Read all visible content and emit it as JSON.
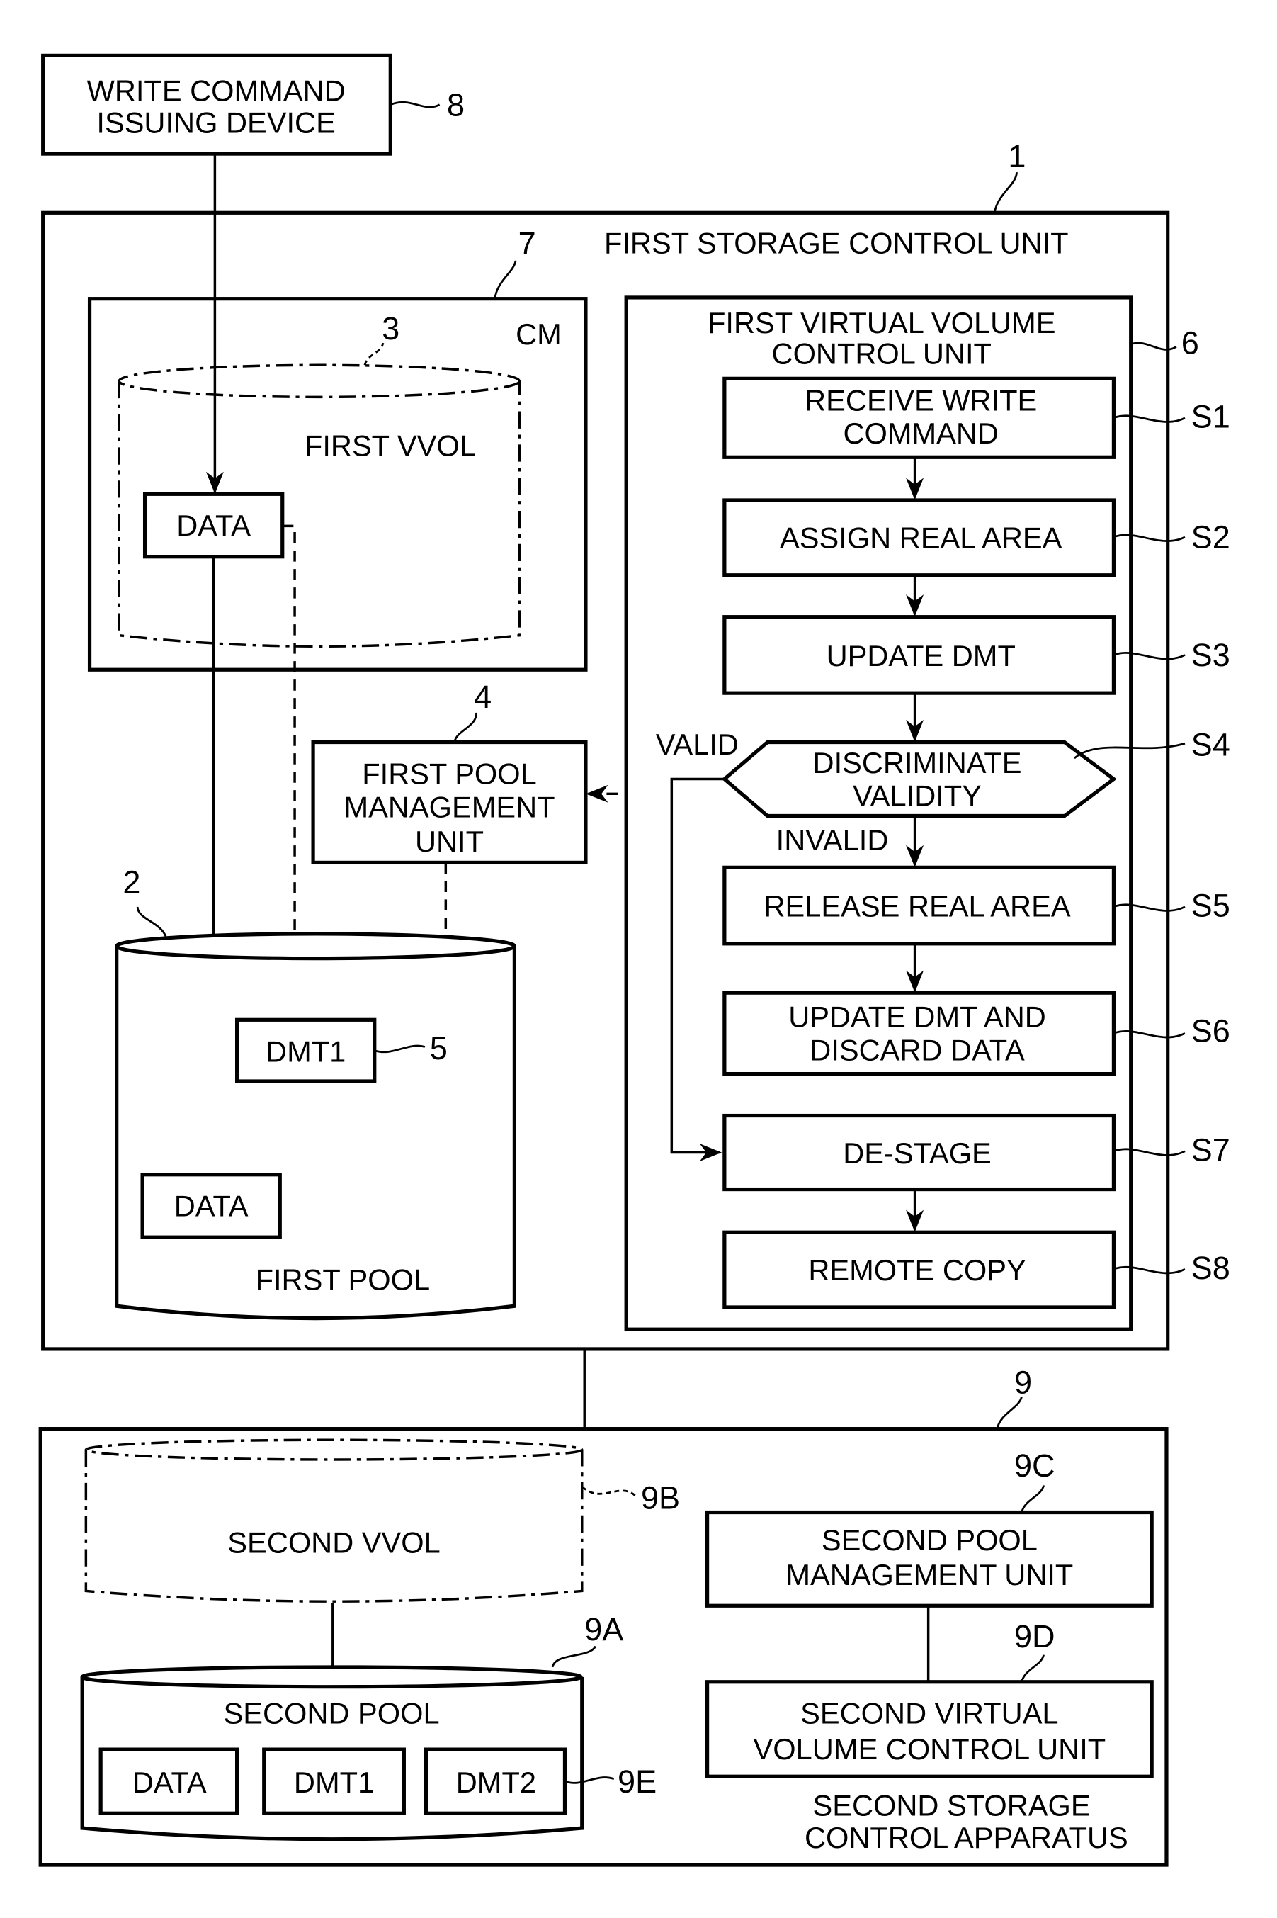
{
  "figure": {
    "write_command_device": {
      "lines": [
        "WRITE COMMAND",
        "ISSUING DEVICE"
      ],
      "ref": "8"
    },
    "first_storage_control_unit": {
      "label": "FIRST STORAGE CONTROL UNIT",
      "ref": "1"
    },
    "cm": {
      "label": "CM",
      "ref": "7"
    },
    "first_vvol": {
      "label": "FIRST VVOL",
      "ref": "3",
      "data_label": "DATA"
    },
    "first_pool_management_unit": {
      "lines": [
        "FIRST POOL",
        "MANAGEMENT",
        "UNIT"
      ],
      "ref": "4"
    },
    "first_pool": {
      "label": "FIRST POOL",
      "ref": "2",
      "dmt_label": "DMT1",
      "dmt_ref": "5",
      "data_label": "DATA"
    },
    "first_virtual_volume_control_unit": {
      "lines": [
        "FIRST VIRTUAL VOLUME",
        "CONTROL UNIT"
      ],
      "ref": "6"
    },
    "steps": [
      {
        "id": "S1",
        "lines": [
          "RECEIVE WRITE",
          "COMMAND"
        ]
      },
      {
        "id": "S2",
        "lines": [
          "ASSIGN REAL AREA"
        ]
      },
      {
        "id": "S3",
        "lines": [
          "UPDATE DMT"
        ]
      },
      {
        "id": "S4",
        "lines": [
          "DISCRIMINATE",
          "VALIDITY"
        ]
      },
      {
        "id": "S5",
        "lines": [
          "RELEASE REAL AREA"
        ]
      },
      {
        "id": "S6",
        "lines": [
          "UPDATE DMT AND",
          "DISCARD DATA"
        ]
      },
      {
        "id": "S7",
        "lines": [
          "DE-STAGE"
        ]
      },
      {
        "id": "S8",
        "lines": [
          "REMOTE COPY"
        ]
      }
    ],
    "branch_labels": {
      "valid": "VALID",
      "invalid": "INVALID"
    },
    "second_storage_control_apparatus": {
      "lines": [
        "SECOND STORAGE",
        "CONTROL APPARATUS"
      ],
      "ref": "9"
    },
    "second_vvol": {
      "label": "SECOND VVOL",
      "ref": "9B"
    },
    "second_pool": {
      "label": "SECOND POOL",
      "ref": "9A",
      "items": [
        "DATA",
        "DMT1",
        "DMT2"
      ],
      "items_ref": "9E"
    },
    "second_pool_management_unit": {
      "lines": [
        "SECOND POOL",
        "MANAGEMENT UNIT"
      ],
      "ref": "9C"
    },
    "second_virtual_volume_control_unit": {
      "lines": [
        "SECOND VIRTUAL",
        "VOLUME CONTROL UNIT"
      ],
      "ref": "9D"
    }
  }
}
